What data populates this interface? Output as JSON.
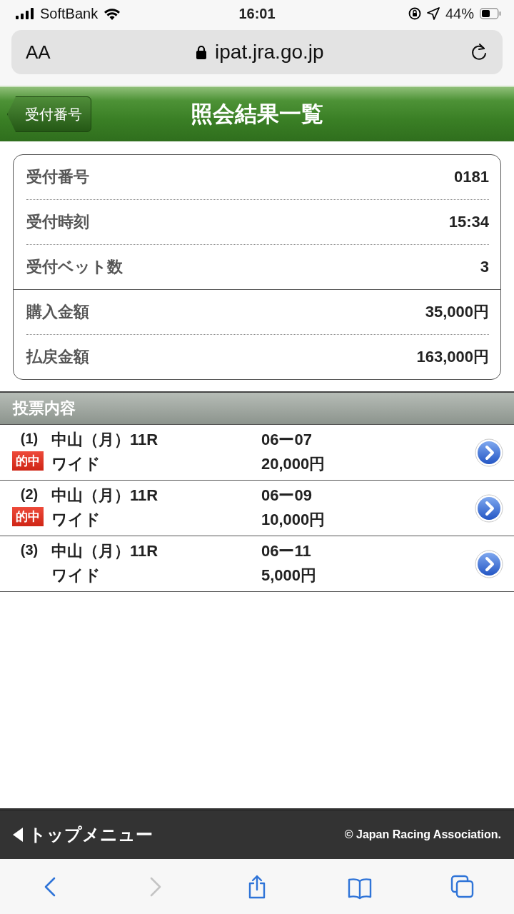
{
  "status_bar": {
    "carrier": "SoftBank",
    "time": "16:01",
    "battery": "44%"
  },
  "address_bar": {
    "text_size": "AA",
    "url": "ipat.jra.go.jp"
  },
  "header": {
    "back": "受付番号",
    "title": "照会結果一覧"
  },
  "summary": {
    "groups": [
      [
        {
          "label": "受付番号",
          "value": "0181"
        },
        {
          "label": "受付時刻",
          "value": "15:34"
        },
        {
          "label": "受付ベット数",
          "value": "3"
        }
      ],
      [
        {
          "label": "購入金額",
          "value": "35,000円"
        },
        {
          "label": "払戻金額",
          "value": "163,000円"
        }
      ]
    ]
  },
  "section": {
    "title": "投票内容"
  },
  "bets": [
    {
      "number": "(1)",
      "race": "中山（月）11R",
      "type": "ワイド",
      "combo": "06ー07",
      "amount": "20,000円",
      "hit": true,
      "hit_label": "的中"
    },
    {
      "number": "(2)",
      "race": "中山（月）11R",
      "type": "ワイド",
      "combo": "06ー09",
      "amount": "10,000円",
      "hit": true,
      "hit_label": "的中"
    },
    {
      "number": "(3)",
      "race": "中山（月）11R",
      "type": "ワイド",
      "combo": "06ー11",
      "amount": "5,000円",
      "hit": false
    }
  ],
  "footer": {
    "menu": "トップメニュー",
    "copyright": "© Japan Racing Association."
  },
  "toolbar": [
    {
      "kind": "back",
      "disabled": false
    },
    {
      "kind": "forward",
      "disabled": true
    },
    {
      "kind": "share",
      "disabled": false
    },
    {
      "kind": "bookmarks",
      "disabled": false
    },
    {
      "kind": "tabs",
      "disabled": false
    }
  ]
}
